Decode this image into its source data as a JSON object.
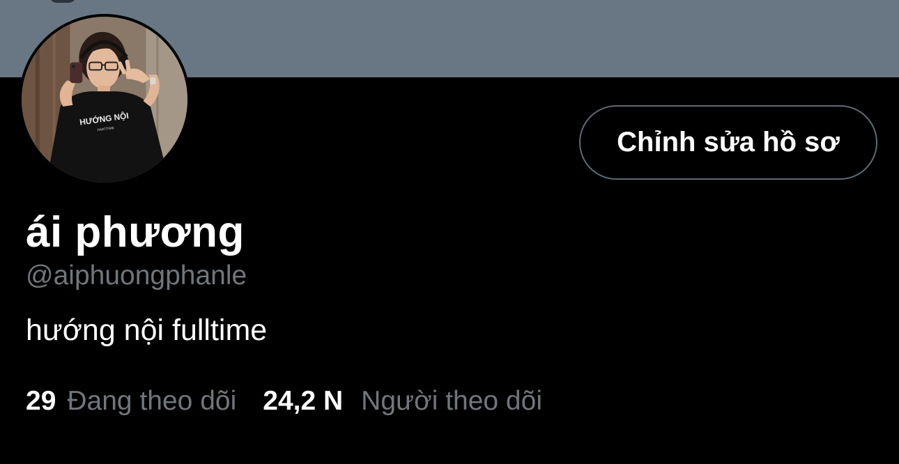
{
  "profile": {
    "display_name": "ái phương",
    "handle": "@aiphuongphanle",
    "bio": "hướng nội fulltime",
    "avatar_shirt_text": "HƯỚNG NỘI",
    "avatar_shirt_subtext": "PARTTIME"
  },
  "actions": {
    "edit_profile_label": "Chỉnh sửa hồ sơ"
  },
  "stats": {
    "following_count": "29",
    "following_label": "Đang theo dõi",
    "followers_count": "24,2 N",
    "followers_label": "Người theo dõi"
  },
  "colors": {
    "background": "#000000",
    "banner": "#697684",
    "muted_text": "#71767b",
    "button_border": "#5f6a74",
    "primary_text": "#ffffff"
  }
}
